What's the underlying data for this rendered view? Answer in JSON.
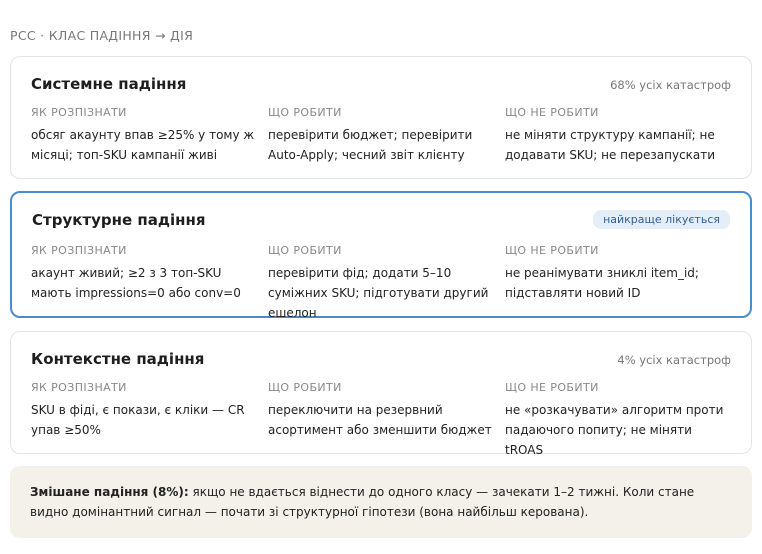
{
  "header": {
    "eyebrow": "РСС · КЛАС ПАДІННЯ → ДІЯ"
  },
  "cards": [
    {
      "title": "Системне падіння",
      "meta": "68% усіх катастроф",
      "columns": [
        {
          "label": "ЯК РОЗПІЗНАТИ",
          "text": "обсяг акаунту впав ≥25% у тому ж місяці; топ-SKU кампанії живі"
        },
        {
          "label": "ЩО РОБИТИ",
          "text": "перевірити бюджет; перевірити Auto-Apply; чесний звіт клієнту"
        },
        {
          "label": "ЩО НЕ РОБИТИ",
          "text": "не міняти структуру кампанії; не додавати SKU; не перезапускати"
        }
      ]
    },
    {
      "title": "Структурне падіння",
      "badge": "найкраще лікується",
      "columns": [
        {
          "label": "ЯК РОЗПІЗНАТИ",
          "text": "акаунт живий; ≥2 з 3 топ-SKU мають impressions=0 або conv=0"
        },
        {
          "label": "ЩО РОБИТИ",
          "text": "перевірити фід; додати 5–10 суміжних SKU; підготувати другий ешелон"
        },
        {
          "label": "ЩО НЕ РОБИТИ",
          "text": "не реанімувати зниклі item_id; підставляти новий ID"
        }
      ]
    },
    {
      "title": "Контекстне падіння",
      "meta": "4% усіх катастроф",
      "columns": [
        {
          "label": "ЯК РОЗПІЗНАТИ",
          "text": "SKU в фіді, є покази, є кліки — CR упав ≥50%"
        },
        {
          "label": "ЩО РОБИТИ",
          "text": "переключити на резервний асортимент або зменшити бюджет"
        },
        {
          "label": "ЩО НЕ РОБИТИ",
          "text": "не «розкачувати» алгоритм проти падаючого попиту; не міняти tROAS"
        }
      ]
    }
  ],
  "note": {
    "lead": "Змішане падіння (8%):",
    "text": " якщо не вдається віднести до одного класу — зачекати 1–2 тижні. Коли стане видно домінантний сигнал — почати зі структурної гіпотези (вона найбільш керована)."
  }
}
